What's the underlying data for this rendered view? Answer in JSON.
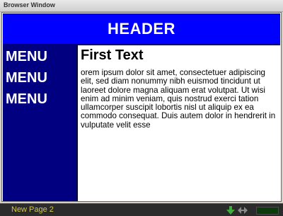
{
  "window": {
    "title": "Browser Window"
  },
  "page": {
    "header": "HEADER",
    "menu": [
      "MENU",
      "MENU",
      "MENU"
    ],
    "content_title": "First Text",
    "content_body": "orem ipsum dolor sit amet, consectetuer adipiscing elit, sed diam nonummy nibh euismod tincidunt ut laoreet dolore magna aliquam erat volutpat. Ut wisi enim ad minim veniam, quis nostrud exerci tation ullamcorper suscipit lobortis nisl ut aliquip ex ea commodo consequat. Duis autem dolor in hendrerit in vulputate velit esse"
  },
  "taskbar": {
    "label": "New Page 2",
    "icons": [
      "download-arrow-icon",
      "navigation-icon",
      "meter-icon"
    ]
  },
  "colors": {
    "header_bg": "#0000ff",
    "sidebar_bg": "#000080",
    "content_bg": "#ffffff",
    "taskbar_text": "#d4c84a"
  }
}
